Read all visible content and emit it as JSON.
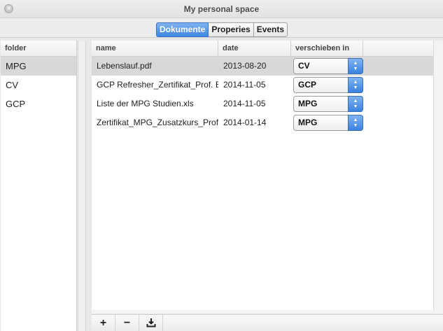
{
  "window": {
    "title": "My personal space",
    "close_glyph": "×"
  },
  "tabs": [
    {
      "label": "Dokumente",
      "active": true
    },
    {
      "label": "Properies",
      "active": false
    },
    {
      "label": "Events",
      "active": false
    }
  ],
  "folders": {
    "header": "folder",
    "items": [
      {
        "label": "MPG",
        "selected": true
      },
      {
        "label": "CV",
        "selected": false
      },
      {
        "label": "GCP",
        "selected": false
      }
    ]
  },
  "documents": {
    "columns": {
      "name": "name",
      "date": "date",
      "move": "verschieben in"
    },
    "rows": [
      {
        "name": "Lebenslauf.pdf",
        "date": "2013-08-20",
        "move": "CV",
        "selected": true
      },
      {
        "name": "GCP Refresher_Zertifikat_Prof. Emmerich.pdf",
        "date": "2014-11-05",
        "move": "GCP",
        "selected": false
      },
      {
        "name": "Liste der MPG Studien.xls",
        "date": "2014-11-05",
        "move": "MPG",
        "selected": false
      },
      {
        "name": "Zertifikat_MPG_Zusatzkurs_Prof.pdf",
        "date": "2014-01-14",
        "move": "MPG",
        "selected": false
      }
    ]
  },
  "toolbar": {
    "add": "+",
    "remove": "−",
    "download_icon": "download-icon"
  },
  "colors": {
    "accent": "#3f86e2",
    "selection": "#d8d8d8"
  }
}
